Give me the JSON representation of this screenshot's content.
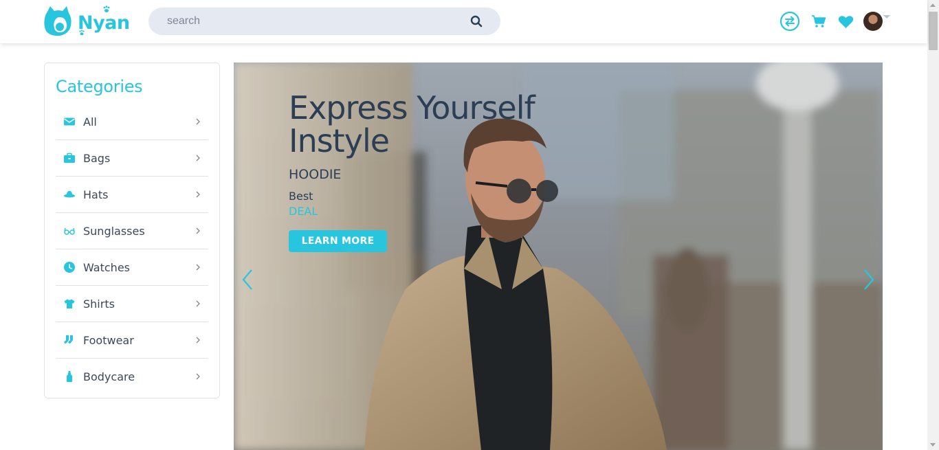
{
  "header": {
    "brand": "Nyan",
    "search": {
      "placeholder": "search",
      "value": ""
    },
    "icons": [
      "compare-icon",
      "cart-icon",
      "heart-icon",
      "avatar"
    ]
  },
  "sidebar": {
    "title": "Categories",
    "items": [
      {
        "label": "All",
        "icon": "envelope-icon"
      },
      {
        "label": "Bags",
        "icon": "briefcase-icon"
      },
      {
        "label": "Hats",
        "icon": "hat-icon"
      },
      {
        "label": "Sunglasses",
        "icon": "glasses-icon"
      },
      {
        "label": "Watches",
        "icon": "clock-icon"
      },
      {
        "label": "Shirts",
        "icon": "shirt-icon"
      },
      {
        "label": "Footwear",
        "icon": "socks-icon"
      },
      {
        "label": "Bodycare",
        "icon": "bottle-icon"
      }
    ]
  },
  "hero": {
    "title": "Express Yourself Instyle",
    "subtitle": "HOODIE",
    "best": "Best",
    "deal": "DEAL",
    "button": "LEARN MORE"
  },
  "colors": {
    "accent": "#28c5df",
    "text": "#3c4858",
    "heading": "#2b3e54"
  }
}
